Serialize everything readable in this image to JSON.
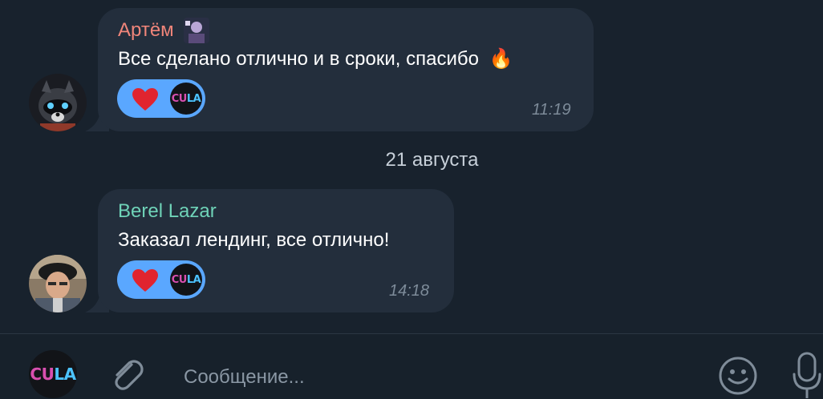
{
  "messages": [
    {
      "sender": "Артём",
      "sender_color": "#f0857a",
      "text": "Все сделано отлично и в сроки, спасибо",
      "emoji": "🔥",
      "reaction": {
        "emoji_name": "heart-icon",
        "reactor": "CULA"
      },
      "time": "11:19"
    },
    {
      "sender": "Berel Lazar",
      "sender_color": "#6fd3b8",
      "text": "Заказал лендинг, все отлично!",
      "reaction": {
        "emoji_name": "heart-icon",
        "reactor": "CULA"
      },
      "time": "14:18"
    }
  ],
  "date_separator": "21 августа",
  "composer": {
    "avatar_text": "CULA",
    "placeholder": "Сообщение..."
  },
  "colors": {
    "background": "#18222d",
    "bubble": "#232e3c",
    "reaction": "#5aa7ff",
    "accent_pink": "#d94fb0",
    "accent_blue": "#4cc3ff"
  }
}
